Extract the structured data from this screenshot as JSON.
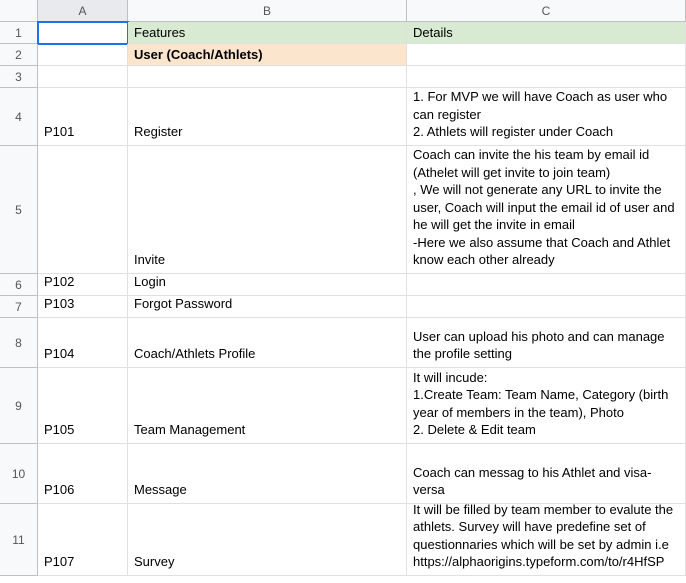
{
  "columns": [
    "A",
    "B",
    "C"
  ],
  "rows": [
    {
      "num": "1",
      "h1": true,
      "a": "",
      "b": "Features",
      "c": "Details"
    },
    {
      "num": "2",
      "h2": true,
      "a": "",
      "b": "User (Coach/Athlets)",
      "c": ""
    },
    {
      "num": "3",
      "a": "",
      "b": "",
      "c": ""
    },
    {
      "num": "4",
      "a": "P101",
      "b": "Register",
      "c": "1. For MVP we will have Coach as user who can register\n2. Athlets will register under Coach"
    },
    {
      "num": "5",
      "a": "",
      "b": "Invite",
      "c": "Coach can invite the his team by email id (Athelet will get invite to join team)\n, We will not generate any URL to invite the user, Coach will input the email id of user and he will get the invite in email\n-Here we also assume that Coach and Athlet know each other already"
    },
    {
      "num": "6",
      "a": "P102",
      "b": "Login",
      "c": ""
    },
    {
      "num": "7",
      "a": "P103",
      "b": "Forgot Password",
      "c": ""
    },
    {
      "num": "8",
      "a": "P104",
      "b": "Coach/Athlets Profile",
      "c": "User can upload his photo and can manage the profile setting"
    },
    {
      "num": "9",
      "a": "P105",
      "b": "Team Management",
      "c": "It will incude:\n1.Create Team: Team Name, Category (birth year of members in the team), Photo\n2. Delete & Edit team"
    },
    {
      "num": "10",
      "a": "P106",
      "b": "Message",
      "c": "Coach can messag to his Athlet and visa-versa"
    },
    {
      "num": "11",
      "a": "P107",
      "b": "Survey",
      "c": "It will be filled by team member to evalute the athlets. Survey will have predefine set of questionnaries which will be set by admin i.e https://alphaorigins.typeform.com/to/r4HfSP"
    }
  ],
  "rowHeights": [
    "22",
    "22",
    "22",
    "58",
    "128",
    "22",
    "22",
    "50",
    "76",
    "60",
    "72"
  ]
}
